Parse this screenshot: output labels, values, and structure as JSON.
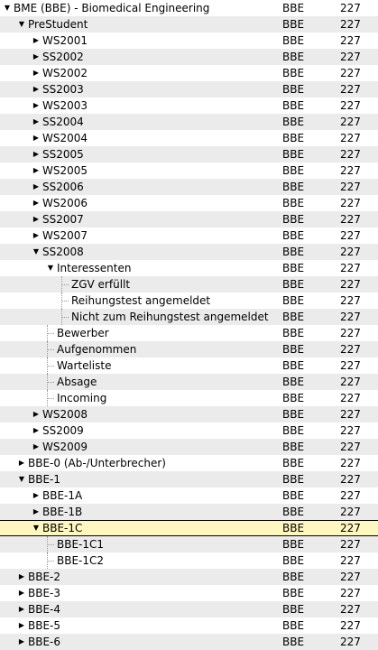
{
  "rows": [
    {
      "name": "BME (BBE) - Biomedical Engineering",
      "code": "BBE",
      "count": "227",
      "level": 0,
      "expander": "expanded"
    },
    {
      "name": "PreStudent",
      "code": "BBE",
      "count": "227",
      "level": 1,
      "expander": "expanded"
    },
    {
      "name": "WS2001",
      "code": "BBE",
      "count": "227",
      "level": 2,
      "expander": "collapsed"
    },
    {
      "name": "SS2002",
      "code": "BBE",
      "count": "227",
      "level": 2,
      "expander": "collapsed"
    },
    {
      "name": "WS2002",
      "code": "BBE",
      "count": "227",
      "level": 2,
      "expander": "collapsed"
    },
    {
      "name": "SS2003",
      "code": "BBE",
      "count": "227",
      "level": 2,
      "expander": "collapsed"
    },
    {
      "name": "WS2003",
      "code": "BBE",
      "count": "227",
      "level": 2,
      "expander": "collapsed"
    },
    {
      "name": "SS2004",
      "code": "BBE",
      "count": "227",
      "level": 2,
      "expander": "collapsed"
    },
    {
      "name": "WS2004",
      "code": "BBE",
      "count": "227",
      "level": 2,
      "expander": "collapsed"
    },
    {
      "name": "SS2005",
      "code": "BBE",
      "count": "227",
      "level": 2,
      "expander": "collapsed"
    },
    {
      "name": "WS2005",
      "code": "BBE",
      "count": "227",
      "level": 2,
      "expander": "collapsed"
    },
    {
      "name": "SS2006",
      "code": "BBE",
      "count": "227",
      "level": 2,
      "expander": "collapsed"
    },
    {
      "name": "WS2006",
      "code": "BBE",
      "count": "227",
      "level": 2,
      "expander": "collapsed"
    },
    {
      "name": "SS2007",
      "code": "BBE",
      "count": "227",
      "level": 2,
      "expander": "collapsed"
    },
    {
      "name": "WS2007",
      "code": "BBE",
      "count": "227",
      "level": 2,
      "expander": "collapsed"
    },
    {
      "name": "SS2008",
      "code": "BBE",
      "count": "227",
      "level": 2,
      "expander": "expanded"
    },
    {
      "name": "Interessenten",
      "code": "BBE",
      "count": "227",
      "level": 3,
      "expander": "expanded"
    },
    {
      "name": "ZGV erfüllt",
      "code": "BBE",
      "count": "227",
      "level": 4,
      "expander": "none"
    },
    {
      "name": "Reihungstest angemeldet",
      "code": "BBE",
      "count": "227",
      "level": 4,
      "expander": "none"
    },
    {
      "name": "Nicht zum Reihungstest angemeldet",
      "code": "BBE",
      "count": "227",
      "level": 4,
      "expander": "none"
    },
    {
      "name": "Bewerber",
      "code": "BBE",
      "count": "227",
      "level": 3,
      "expander": "none"
    },
    {
      "name": "Aufgenommen",
      "code": "BBE",
      "count": "227",
      "level": 3,
      "expander": "none"
    },
    {
      "name": "Warteliste",
      "code": "BBE",
      "count": "227",
      "level": 3,
      "expander": "none"
    },
    {
      "name": "Absage",
      "code": "BBE",
      "count": "227",
      "level": 3,
      "expander": "none"
    },
    {
      "name": "Incoming",
      "code": "BBE",
      "count": "227",
      "level": 3,
      "expander": "none"
    },
    {
      "name": "WS2008",
      "code": "BBE",
      "count": "227",
      "level": 2,
      "expander": "collapsed"
    },
    {
      "name": "SS2009",
      "code": "BBE",
      "count": "227",
      "level": 2,
      "expander": "collapsed"
    },
    {
      "name": "WS2009",
      "code": "BBE",
      "count": "227",
      "level": 2,
      "expander": "collapsed"
    },
    {
      "name": "BBE-0  (Ab-/Unterbrecher)",
      "code": "BBE",
      "count": "227",
      "level": 1,
      "expander": "collapsed"
    },
    {
      "name": "BBE-1",
      "code": "BBE",
      "count": "227",
      "level": 1,
      "expander": "expanded"
    },
    {
      "name": "BBE-1A",
      "code": "BBE",
      "count": "227",
      "level": 2,
      "expander": "collapsed"
    },
    {
      "name": "BBE-1B",
      "code": "BBE",
      "count": "227",
      "level": 2,
      "expander": "collapsed"
    },
    {
      "name": "BBE-1C",
      "code": "BBE",
      "count": "227",
      "level": 2,
      "expander": "expanded",
      "selected": true
    },
    {
      "name": "BBE-1C1",
      "code": "BBE",
      "count": "227",
      "level": 3,
      "expander": "none"
    },
    {
      "name": "BBE-1C2",
      "code": "BBE",
      "count": "227",
      "level": 3,
      "expander": "none"
    },
    {
      "name": "BBE-2",
      "code": "BBE",
      "count": "227",
      "level": 1,
      "expander": "collapsed"
    },
    {
      "name": "BBE-3",
      "code": "BBE",
      "count": "227",
      "level": 1,
      "expander": "collapsed"
    },
    {
      "name": "BBE-4",
      "code": "BBE",
      "count": "227",
      "level": 1,
      "expander": "collapsed"
    },
    {
      "name": "BBE-5",
      "code": "BBE",
      "count": "227",
      "level": 1,
      "expander": "collapsed"
    },
    {
      "name": "BBE-6",
      "code": "BBE",
      "count": "227",
      "level": 1,
      "expander": "collapsed"
    }
  ],
  "icons": {
    "expanded": "triangle-down-icon",
    "collapsed": "triangle-right-icon"
  },
  "colors": {
    "selected_row": "#fff7c0",
    "alt_row": "#ebebeb"
  }
}
